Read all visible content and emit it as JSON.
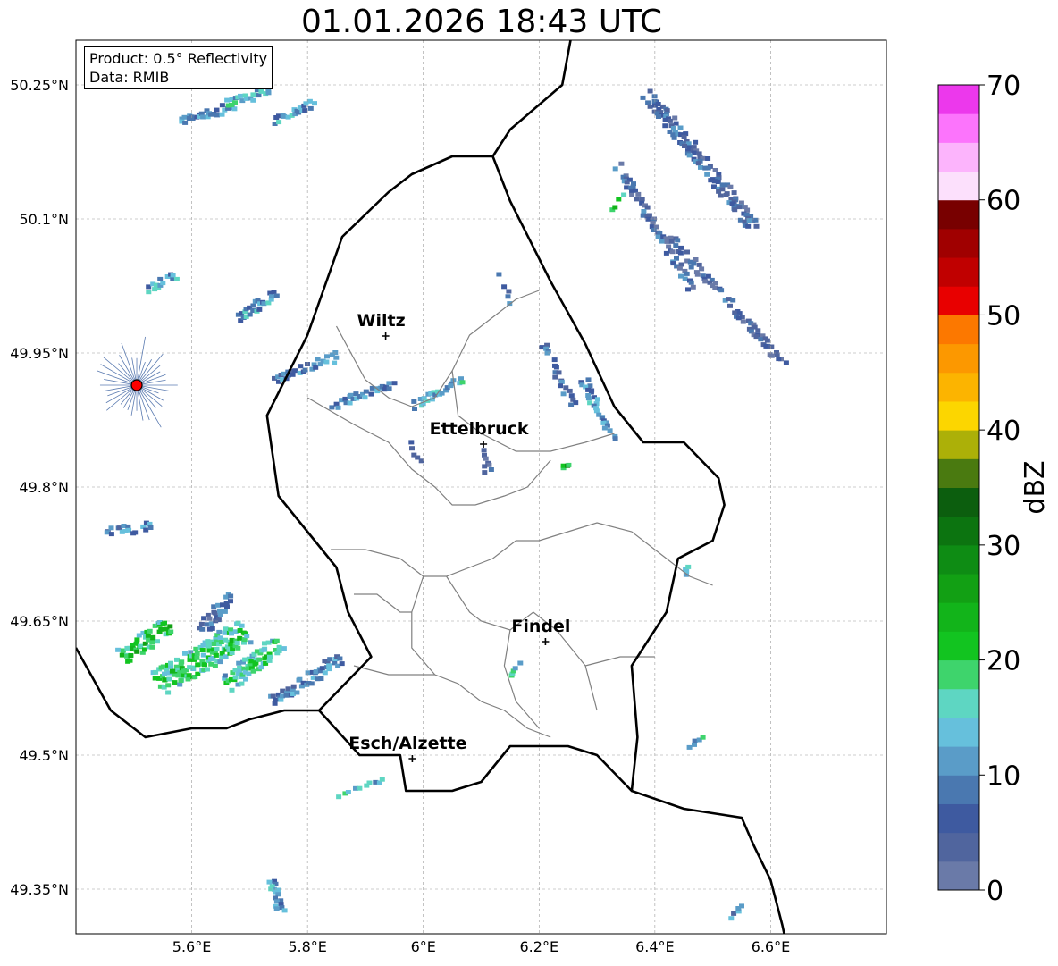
{
  "title": "01.01.2026 18:43 UTC",
  "info": {
    "product_line": "Product: 0.5° Reflectivity",
    "data_line": "Data: RMIB"
  },
  "map": {
    "lon_range": [
      5.4,
      6.8
    ],
    "lat_range": [
      49.3,
      50.3
    ],
    "lon_ticks": [
      {
        "value": 5.6,
        "label": "5.6°E"
      },
      {
        "value": 5.8,
        "label": "5.8°E"
      },
      {
        "value": 6.0,
        "label": "6°E"
      },
      {
        "value": 6.2,
        "label": "6.2°E"
      },
      {
        "value": 6.4,
        "label": "6.4°E"
      },
      {
        "value": 6.6,
        "label": "6.6°E"
      }
    ],
    "lat_ticks": [
      {
        "value": 50.25,
        "label": "50.25°N"
      },
      {
        "value": 50.1,
        "label": "50.1°N"
      },
      {
        "value": 49.95,
        "label": "49.95°N"
      },
      {
        "value": 49.8,
        "label": "49.8°N"
      },
      {
        "value": 49.65,
        "label": "49.65°N"
      },
      {
        "value": 49.5,
        "label": "49.5°N"
      },
      {
        "value": 49.35,
        "label": "49.35°N"
      }
    ],
    "cities": [
      {
        "name": "Wiltz",
        "lon": 5.935,
        "lat": 49.969
      },
      {
        "name": "Ettelbruck",
        "lon": 6.104,
        "lat": 49.848
      },
      {
        "name": "Findel",
        "lon": 6.211,
        "lat": 49.627
      },
      {
        "name": "Esch/Alzette",
        "lon": 5.981,
        "lat": 49.496
      }
    ],
    "radar_site": {
      "name": "radar-site",
      "lon": 5.505,
      "lat": 49.914,
      "color": "#ff0000"
    },
    "country_border": [
      [
        5.82,
        49.55
      ],
      [
        5.89,
        49.5
      ],
      [
        5.96,
        49.5
      ],
      [
        5.97,
        49.46
      ],
      [
        6.05,
        49.46
      ],
      [
        6.1,
        49.47
      ],
      [
        6.15,
        49.51
      ],
      [
        6.25,
        49.51
      ],
      [
        6.3,
        49.5
      ],
      [
        6.36,
        49.46
      ],
      [
        6.37,
        49.52
      ],
      [
        6.36,
        49.6
      ],
      [
        6.42,
        49.66
      ],
      [
        6.44,
        49.72
      ],
      [
        6.5,
        49.74
      ],
      [
        6.52,
        49.78
      ],
      [
        6.51,
        49.81
      ],
      [
        6.45,
        49.85
      ],
      [
        6.38,
        49.85
      ],
      [
        6.33,
        49.89
      ],
      [
        6.28,
        49.96
      ],
      [
        6.22,
        50.03
      ],
      [
        6.15,
        50.12
      ],
      [
        6.12,
        50.17
      ],
      [
        6.05,
        50.17
      ],
      [
        5.98,
        50.15
      ],
      [
        5.94,
        50.13
      ],
      [
        5.86,
        50.08
      ],
      [
        5.8,
        49.97
      ],
      [
        5.73,
        49.88
      ],
      [
        5.75,
        49.79
      ],
      [
        5.85,
        49.71
      ],
      [
        5.87,
        49.66
      ],
      [
        5.91,
        49.61
      ],
      [
        5.82,
        49.55
      ]
    ],
    "neighbor_borders": [
      [
        [
          5.4,
          49.62
        ],
        [
          5.46,
          49.55
        ],
        [
          5.52,
          49.52
        ],
        [
          5.6,
          49.53
        ],
        [
          5.66,
          49.53
        ],
        [
          5.7,
          49.54
        ],
        [
          5.76,
          49.55
        ],
        [
          5.82,
          49.55
        ]
      ],
      [
        [
          6.12,
          50.17
        ],
        [
          6.15,
          50.2
        ],
        [
          6.24,
          50.25
        ],
        [
          6.26,
          50.32
        ]
      ],
      [
        [
          6.36,
          49.46
        ],
        [
          6.45,
          49.44
        ],
        [
          6.55,
          49.43
        ],
        [
          6.57,
          49.4
        ],
        [
          6.6,
          49.36
        ],
        [
          6.62,
          49.31
        ],
        [
          6.63,
          49.28
        ]
      ]
    ],
    "canton_lines": [
      [
        [
          5.85,
          49.98
        ],
        [
          5.9,
          49.92
        ],
        [
          5.94,
          49.9
        ],
        [
          5.98,
          49.89
        ],
        [
          6.02,
          49.9
        ],
        [
          6.05,
          49.93
        ],
        [
          6.08,
          49.97
        ],
        [
          6.12,
          49.99
        ],
        [
          6.16,
          50.01
        ],
        [
          6.2,
          50.02
        ]
      ],
      [
        [
          6.05,
          49.93
        ],
        [
          6.06,
          49.88
        ],
        [
          6.1,
          49.86
        ],
        [
          6.16,
          49.84
        ],
        [
          6.22,
          49.84
        ],
        [
          6.28,
          49.85
        ],
        [
          6.33,
          49.86
        ]
      ],
      [
        [
          5.8,
          49.9
        ],
        [
          5.88,
          49.87
        ],
        [
          5.94,
          49.85
        ],
        [
          5.98,
          49.82
        ],
        [
          6.02,
          49.8
        ],
        [
          6.05,
          49.78
        ],
        [
          6.09,
          49.78
        ],
        [
          6.14,
          49.79
        ],
        [
          6.18,
          49.8
        ],
        [
          6.22,
          49.83
        ]
      ],
      [
        [
          5.84,
          49.73
        ],
        [
          5.9,
          49.73
        ],
        [
          5.96,
          49.72
        ],
        [
          6.0,
          49.7
        ],
        [
          6.04,
          49.7
        ],
        [
          6.08,
          49.71
        ],
        [
          6.12,
          49.72
        ],
        [
          6.16,
          49.74
        ],
        [
          6.2,
          49.74
        ]
      ],
      [
        [
          6.0,
          49.7
        ],
        [
          5.98,
          49.66
        ],
        [
          5.98,
          49.62
        ],
        [
          6.02,
          49.59
        ],
        [
          6.06,
          49.58
        ],
        [
          6.1,
          49.56
        ],
        [
          6.14,
          49.55
        ],
        [
          6.18,
          49.53
        ],
        [
          6.22,
          49.52
        ]
      ],
      [
        [
          6.04,
          49.7
        ],
        [
          6.08,
          49.66
        ],
        [
          6.1,
          49.65
        ],
        [
          6.15,
          49.64
        ],
        [
          6.19,
          49.66
        ],
        [
          6.23,
          49.64
        ],
        [
          6.28,
          49.6
        ],
        [
          6.3,
          49.55
        ]
      ],
      [
        [
          6.2,
          49.74
        ],
        [
          6.25,
          49.75
        ],
        [
          6.3,
          49.76
        ],
        [
          6.36,
          49.75
        ],
        [
          6.42,
          49.72
        ],
        [
          6.46,
          49.7
        ],
        [
          6.5,
          49.69
        ]
      ],
      [
        [
          6.15,
          49.64
        ],
        [
          6.14,
          49.6
        ],
        [
          6.16,
          49.56
        ],
        [
          6.2,
          49.53
        ]
      ],
      [
        [
          5.88,
          49.6
        ],
        [
          5.94,
          49.59
        ],
        [
          5.98,
          49.59
        ],
        [
          6.02,
          49.59
        ]
      ],
      [
        [
          5.88,
          49.68
        ],
        [
          5.92,
          49.68
        ],
        [
          5.96,
          49.66
        ],
        [
          5.98,
          49.66
        ]
      ],
      [
        [
          6.28,
          49.6
        ],
        [
          6.34,
          49.61
        ],
        [
          6.4,
          49.61
        ]
      ]
    ]
  },
  "colorbar": {
    "label": "dBZ",
    "vmin": 0,
    "vmax": 70,
    "tick_labels": [
      0,
      10,
      20,
      30,
      40,
      50,
      60,
      70
    ],
    "colors": [
      "#6a7aa8",
      "#50659e",
      "#3e5aa0",
      "#4a78b0",
      "#5a9cc8",
      "#66c0dc",
      "#5ed6c2",
      "#3ed46c",
      "#12c420",
      "#12b41a",
      "#12a014",
      "#0e8c14",
      "#0c7410",
      "#0c5e0e",
      "#4a7a10",
      "#acb008",
      "#fcd600",
      "#fcb400",
      "#fc9800",
      "#fc7800",
      "#e80000",
      "#c00000",
      "#a00000",
      "#780000",
      "#fce0fc",
      "#fcb4fc",
      "#fc74fc",
      "#ec38ec"
    ]
  },
  "radar_echoes": [
    {
      "lon": 6.38,
      "lat": 50.24,
      "len": 0.3,
      "dir": [
        0.4,
        -0.5
      ],
      "width": 14,
      "dbz": 8
    },
    {
      "lon": 6.33,
      "lat": 50.16,
      "len": 0.25,
      "dir": [
        0.3,
        -0.5
      ],
      "width": 12,
      "dbz": 7
    },
    {
      "lon": 6.42,
      "lat": 50.08,
      "len": 0.3,
      "dir": [
        0.4,
        -0.45
      ],
      "width": 10,
      "dbz": 6
    },
    {
      "lon": 6.27,
      "lat": 49.92,
      "len": 0.12,
      "dir": [
        0.2,
        -0.4
      ],
      "width": 8,
      "dbz": 12
    },
    {
      "lon": 6.2,
      "lat": 49.96,
      "len": 0.12,
      "dir": [
        0.2,
        -0.4
      ],
      "width": 8,
      "dbz": 8
    },
    {
      "lon": 5.54,
      "lat": 49.58,
      "len": 0.18,
      "dir": [
        0.5,
        0.3
      ],
      "width": 28,
      "dbz": 20
    },
    {
      "lon": 5.66,
      "lat": 49.58,
      "len": 0.12,
      "dir": [
        0.5,
        0.4
      ],
      "width": 22,
      "dbz": 18
    },
    {
      "lon": 5.48,
      "lat": 49.61,
      "len": 0.1,
      "dir": [
        0.4,
        0.3
      ],
      "width": 18,
      "dbz": 22
    },
    {
      "lon": 5.74,
      "lat": 49.56,
      "len": 0.14,
      "dir": [
        0.6,
        0.4
      ],
      "width": 16,
      "dbz": 10
    },
    {
      "lon": 5.62,
      "lat": 49.64,
      "len": 0.08,
      "dir": [
        0.4,
        0.6
      ],
      "width": 14,
      "dbz": 8
    },
    {
      "lon": 5.58,
      "lat": 50.21,
      "len": 0.1,
      "dir": [
        0.7,
        0.2
      ],
      "width": 8,
      "dbz": 10
    },
    {
      "lon": 5.66,
      "lat": 50.23,
      "len": 0.08,
      "dir": [
        0.7,
        0.2
      ],
      "width": 8,
      "dbz": 14
    },
    {
      "lon": 5.74,
      "lat": 50.21,
      "len": 0.08,
      "dir": [
        0.7,
        0.3
      ],
      "width": 8,
      "dbz": 12
    },
    {
      "lon": 5.68,
      "lat": 49.99,
      "len": 0.08,
      "dir": [
        0.6,
        0.4
      ],
      "width": 8,
      "dbz": 12
    },
    {
      "lon": 5.74,
      "lat": 49.92,
      "len": 0.12,
      "dir": [
        0.8,
        0.3
      ],
      "width": 8,
      "dbz": 10
    },
    {
      "lon": 5.84,
      "lat": 49.89,
      "len": 0.12,
      "dir": [
        0.8,
        0.3
      ],
      "width": 10,
      "dbz": 12
    },
    {
      "lon": 5.98,
      "lat": 49.89,
      "len": 0.1,
      "dir": [
        0.7,
        0.4
      ],
      "width": 10,
      "dbz": 14
    },
    {
      "lon": 5.52,
      "lat": 50.02,
      "len": 0.06,
      "dir": [
        0.7,
        0.4
      ],
      "width": 8,
      "dbz": 12
    },
    {
      "lon": 6.12,
      "lat": 50.04,
      "len": 0.06,
      "dir": [
        0.3,
        -0.6
      ],
      "width": 6,
      "dbz": 8
    },
    {
      "lon": 6.09,
      "lat": 49.84,
      "len": 0.04,
      "dir": [
        0.3,
        -0.6
      ],
      "width": 10,
      "dbz": 6
    },
    {
      "lon": 5.73,
      "lat": 49.36,
      "len": 0.06,
      "dir": [
        0.2,
        -0.6
      ],
      "width": 12,
      "dbz": 12
    },
    {
      "lon": 5.84,
      "lat": 49.45,
      "len": 0.1,
      "dir": [
        0.7,
        0.3
      ],
      "width": 6,
      "dbz": 14
    },
    {
      "lon": 5.97,
      "lat": 49.85,
      "len": 0.04,
      "dir": [
        0.3,
        -0.6
      ],
      "width": 6,
      "dbz": 8
    },
    {
      "lon": 6.33,
      "lat": 50.11,
      "len": 0.04,
      "dir": [
        0.3,
        0.6
      ],
      "width": 6,
      "dbz": 22
    },
    {
      "lon": 6.24,
      "lat": 49.82,
      "len": 0.02,
      "dir": [
        0.3,
        0.6
      ],
      "width": 6,
      "dbz": 24
    },
    {
      "lon": 6.15,
      "lat": 49.59,
      "len": 0.03,
      "dir": [
        0.5,
        0.5
      ],
      "width": 6,
      "dbz": 16
    },
    {
      "lon": 6.46,
      "lat": 49.51,
      "len": 0.03,
      "dir": [
        0.5,
        0.5
      ],
      "width": 5,
      "dbz": 14
    },
    {
      "lon": 6.53,
      "lat": 49.32,
      "len": 0.03,
      "dir": [
        0.5,
        0.5
      ],
      "width": 6,
      "dbz": 10
    },
    {
      "lon": 6.45,
      "lat": 49.7,
      "len": 0.03,
      "dir": [
        0.2,
        0.6
      ],
      "width": 5,
      "dbz": 16
    },
    {
      "lon": 5.45,
      "lat": 49.75,
      "len": 0.08,
      "dir": [
        0.8,
        0.1
      ],
      "width": 8,
      "dbz": 10
    }
  ]
}
